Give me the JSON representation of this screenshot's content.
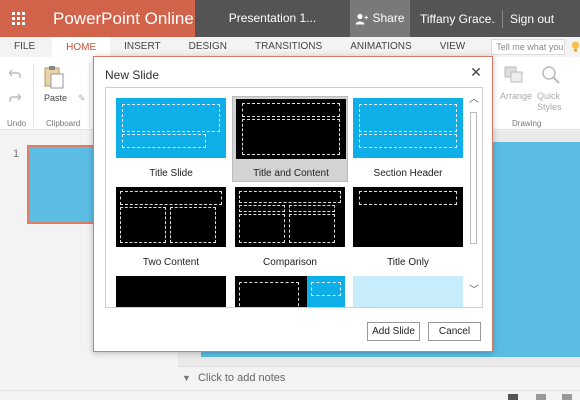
{
  "app": {
    "name": "PowerPoint Online",
    "presentation_title": "Presentation 1...",
    "share_label": "Share",
    "user_name": "Tiffany Grace...",
    "signout_label": "Sign out"
  },
  "ribbon": {
    "tabs": [
      "FILE",
      "HOME",
      "INSERT",
      "DESIGN",
      "TRANSITIONS",
      "ANIMATIONS",
      "VIEW"
    ],
    "active_tab": "HOME",
    "tell_me_placeholder": "Tell me what you want to do",
    "undo_label": "Undo",
    "clipboard_label": "Clipboard",
    "paste_label": "Paste",
    "arrange_label": "Arrange",
    "quick_styles_label": "Quick Styles",
    "drawing_label": "Drawing"
  },
  "slides_pane": {
    "slide_number": "1"
  },
  "notes": {
    "placeholder": "Click to add notes"
  },
  "dialog": {
    "title": "New Slide",
    "layouts": [
      {
        "label": "Title Slide",
        "style": "blue",
        "selected": false
      },
      {
        "label": "Title and Content",
        "style": "black",
        "selected": true
      },
      {
        "label": "Section Header",
        "style": "blue",
        "selected": false
      },
      {
        "label": "Two Content",
        "style": "black",
        "selected": false
      },
      {
        "label": "Comparison",
        "style": "black",
        "selected": false
      },
      {
        "label": "Title Only",
        "style": "black",
        "selected": false
      }
    ],
    "add_button": "Add Slide",
    "cancel_button": "Cancel"
  },
  "colors": {
    "brand": "#d0634a",
    "slide_blue": "#5bbde4",
    "layout_blue": "#0eaee8",
    "dark_bar": "#545454"
  }
}
